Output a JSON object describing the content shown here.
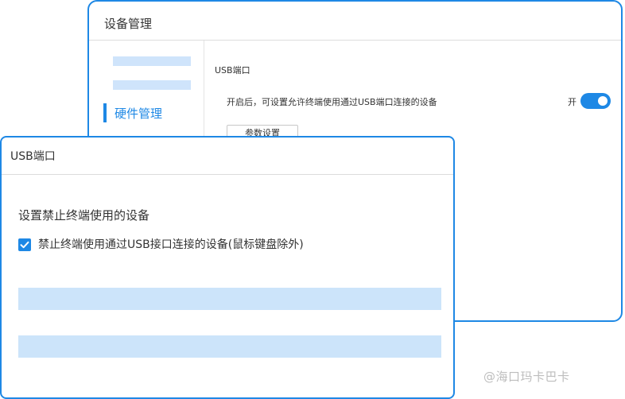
{
  "back_window": {
    "title": "设备管理",
    "sidebar": {
      "active_label": "硬件管理"
    },
    "usb_section": {
      "title": "USB端口",
      "description": "开启后，可设置允许终端使用通过USB端口连接的设备",
      "toggle_label": "开",
      "toggle_on": true,
      "param_button": "参数设置"
    }
  },
  "front_window": {
    "title": "USB端口",
    "heading": "设置禁止终端使用的设备",
    "checkbox": {
      "checked": true,
      "label": "禁止终端使用通过USB接口连接的设备(鼠标键盘除外)"
    }
  },
  "watermark": "@海口玛卡巴卡",
  "colors": {
    "accent": "#1e88e5",
    "placeholder": "#cce4fa"
  }
}
